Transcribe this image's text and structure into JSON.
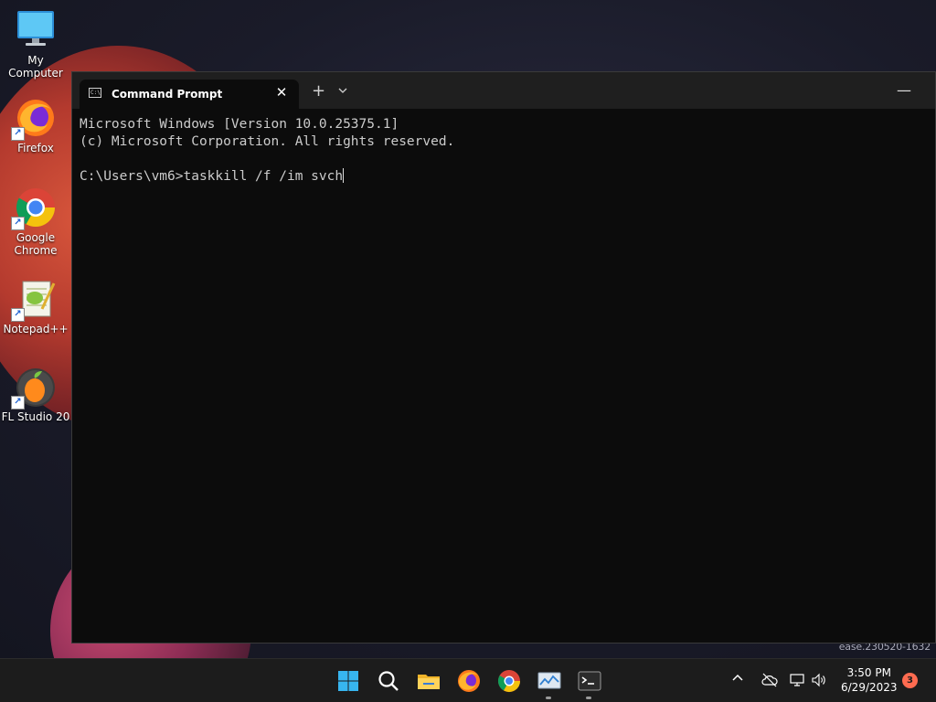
{
  "desktop": {
    "icons": [
      {
        "label": "My Computer",
        "icon": "monitor-icon"
      },
      {
        "label": "Firefox",
        "icon": "firefox-icon"
      },
      {
        "label": "Google Chrome",
        "icon": "chrome-icon"
      },
      {
        "label": "Notepad++",
        "icon": "notepadpp-icon"
      },
      {
        "label": "FL Studio 20",
        "icon": "flstudio-icon"
      }
    ],
    "version_watermark": "ease.230520-1632"
  },
  "terminal": {
    "tab_title": "Command Prompt",
    "tab_icon_glyph": "C:\\",
    "close_glyph": "✕",
    "new_tab_glyph": "+",
    "dropdown_glyph": "⌄",
    "minimize_glyph": "—",
    "lines": [
      "Microsoft Windows [Version 10.0.25375.1]",
      "(c) Microsoft Corporation. All rights reserved.",
      "",
      "C:\\Users\\vm6>taskkill /f /im svch"
    ]
  },
  "taskbar": {
    "apps": [
      {
        "name": "Start",
        "icon": "windows-start-icon"
      },
      {
        "name": "Search",
        "icon": "search-icon"
      },
      {
        "name": "File Explorer",
        "icon": "folder-icon"
      },
      {
        "name": "Firefox",
        "icon": "firefox-icon"
      },
      {
        "name": "Google Chrome",
        "icon": "chrome-icon"
      },
      {
        "name": "Task Manager",
        "icon": "task-manager-icon"
      },
      {
        "name": "Terminal",
        "icon": "terminal-icon"
      }
    ],
    "tray": {
      "chevron_glyph": "^",
      "time": "3:50 PM",
      "date": "6/29/2023",
      "notification_count": "3"
    }
  },
  "colors": {
    "terminal_bg": "#0c0c0c",
    "titlebar_bg": "#1f1f1f",
    "taskbar_bg": "#1c1c1c",
    "badge": "#ff6b50"
  }
}
